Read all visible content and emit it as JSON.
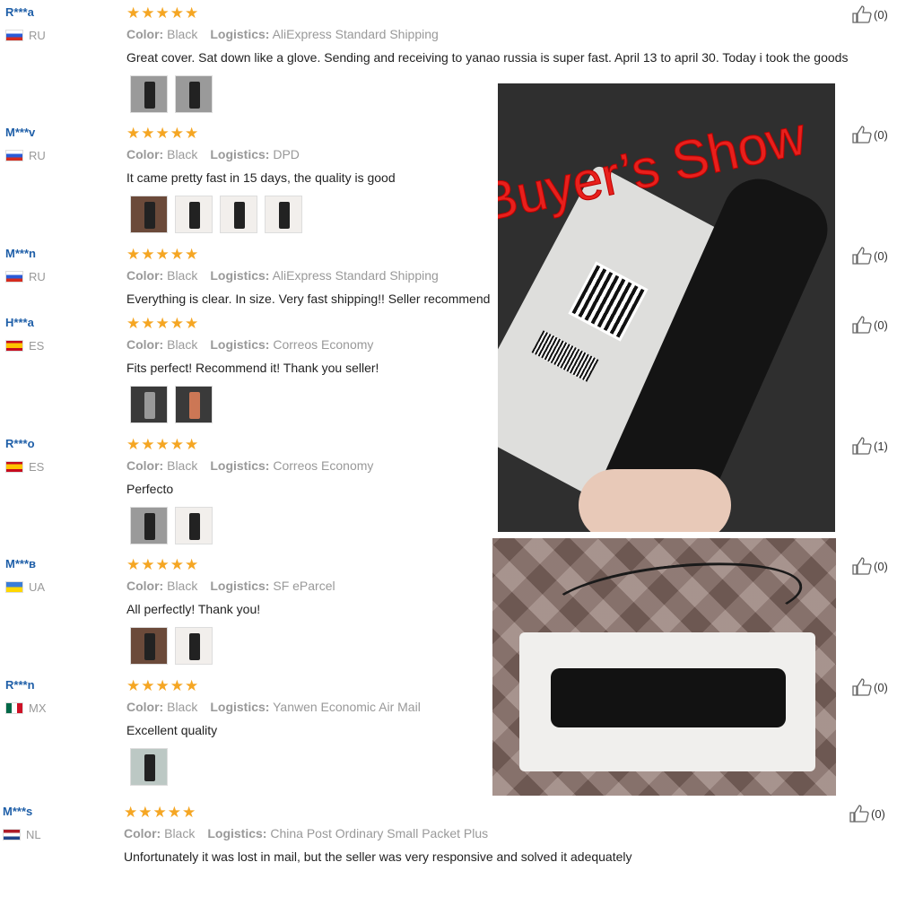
{
  "reviews": [
    {
      "user": "R***a",
      "country": "RU",
      "color_label": "Color:",
      "color": "Black",
      "logistics_label": "Logistics:",
      "logistics": "AliExpress Standard Shipping",
      "text": "Great cover. Sat down like a glove. Sending and receiving to yanao russia is super fast. April 13 to april 30. Today i took the goods",
      "likes": "(0)",
      "photos": 2
    },
    {
      "user": "M***v",
      "country": "RU",
      "color_label": "Color:",
      "color": "Black",
      "logistics_label": "Logistics:",
      "logistics": "DPD",
      "text": "It came pretty fast in 15 days, the quality is good",
      "likes": "(0)",
      "photos": 4
    },
    {
      "user": "M***n",
      "country": "RU",
      "color_label": "Color:",
      "color": "Black",
      "logistics_label": "Logistics:",
      "logistics": "AliExpress Standard Shipping",
      "text": "Everything is clear. In size. Very fast shipping!! Seller recommend",
      "likes": "(0)",
      "photos": 0
    },
    {
      "user": "H***a",
      "country": "ES",
      "color_label": "Color:",
      "color": "Black",
      "logistics_label": "Logistics:",
      "logistics": "Correos Economy",
      "text": "Fits perfect! Recommend it! Thank you seller!",
      "likes": "(0)",
      "photos": 2
    },
    {
      "user": "R***o",
      "country": "ES",
      "color_label": "Color:",
      "color": "Black",
      "logistics_label": "Logistics:",
      "logistics": "Correos Economy",
      "text": "Perfecto",
      "likes": "(1)",
      "photos": 2
    },
    {
      "user": "M***в",
      "country": "UA",
      "color_label": "Color:",
      "color": "Black",
      "logistics_label": "Logistics:",
      "logistics": "SF eParcel",
      "text": "All perfectly! Thank you!",
      "likes": "(0)",
      "photos": 2
    },
    {
      "user": "R***n",
      "country": "MX",
      "color_label": "Color:",
      "color": "Black",
      "logistics_label": "Logistics:",
      "logistics": "Yanwen Economic Air Mail",
      "text": "Excellent quality",
      "likes": "(0)",
      "photos": 1
    },
    {
      "user": "M***s",
      "country": "NL",
      "color_label": "Color:",
      "color": "Black",
      "logistics_label": "Logistics:",
      "logistics": "China Post Ordinary Small Packet Plus",
      "text": "Unfortunately it was lost in mail, but the seller was very responsive and solved it adequately",
      "likes": "(0)",
      "photos": 0
    }
  ],
  "stars_glyphs": "★★★★★",
  "overlay": {
    "title": "Buyer’s Show"
  },
  "colors": {
    "star": "#f5a623",
    "username": "#1f5fa8",
    "overlay_title": "#e8201c"
  }
}
